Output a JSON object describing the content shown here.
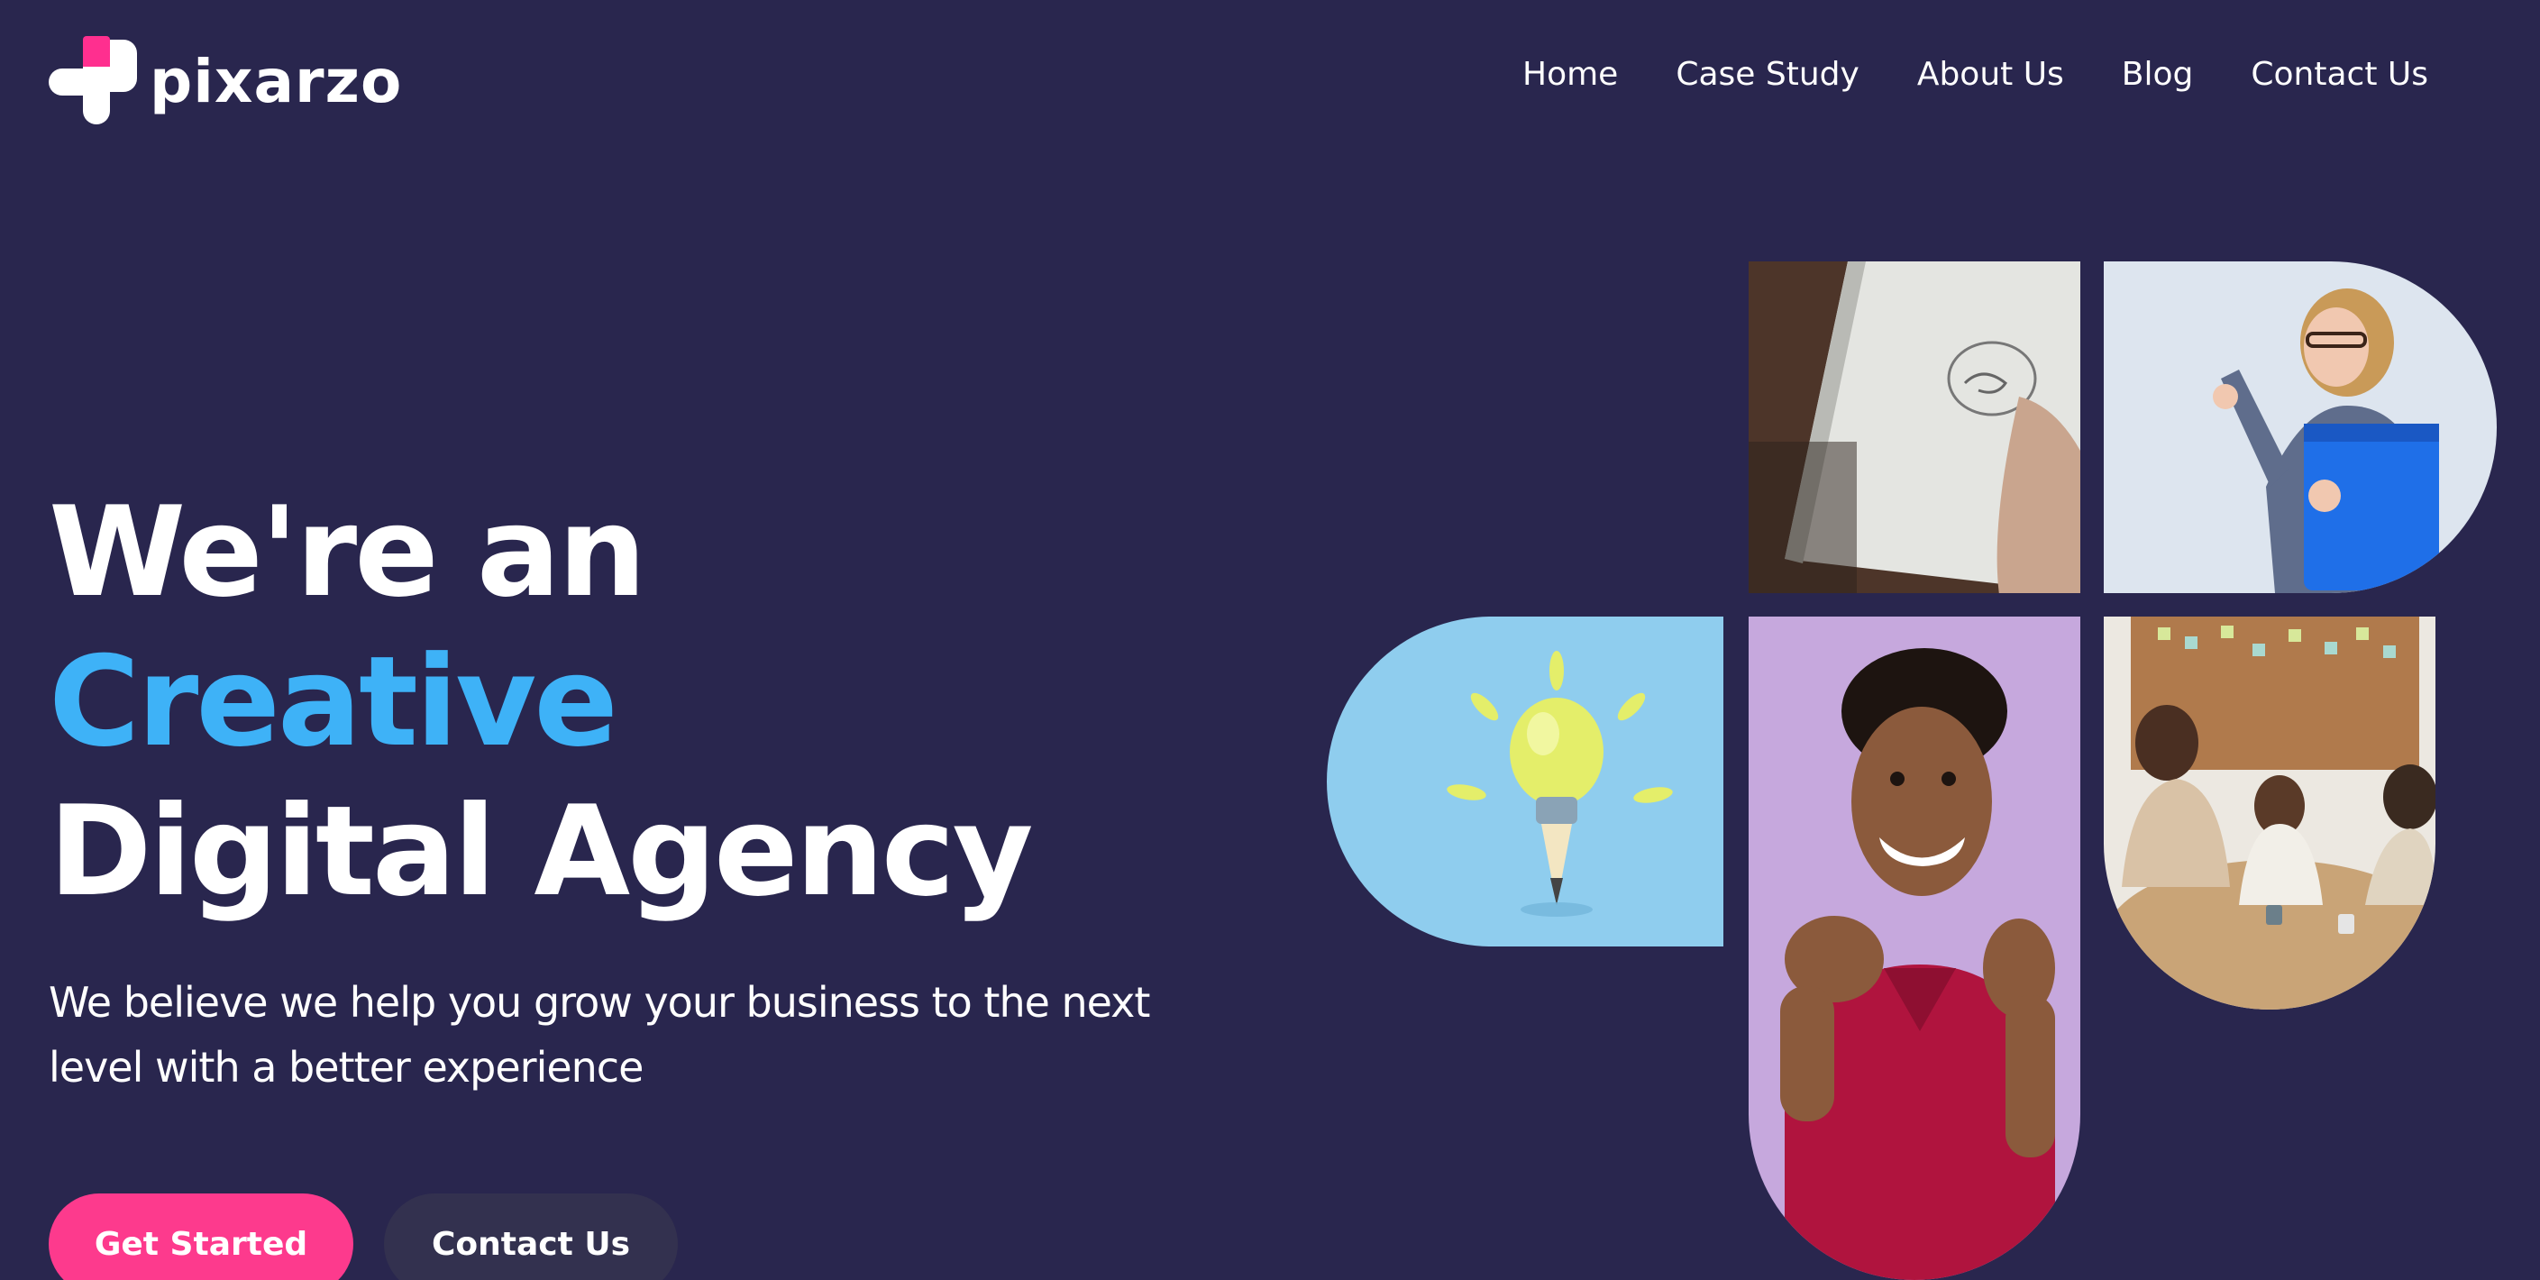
{
  "brand": {
    "name": "pixarzo"
  },
  "nav": {
    "items": [
      {
        "label": "Home"
      },
      {
        "label": "Case Study"
      },
      {
        "label": "About Us"
      },
      {
        "label": "Blog"
      },
      {
        "label": "Contact Us"
      }
    ]
  },
  "hero": {
    "headline_part1": "We're an ",
    "headline_accent": "Creative",
    "headline_part2": "Digital Agency",
    "subtext": "We believe we help you grow your business to the next level with a better experience",
    "primary_button": "Get Started",
    "secondary_button": "Contact Us"
  },
  "colors": {
    "background": "#29264e",
    "accent_blue": "#3eb2f7",
    "accent_pink": "#fd3a8d",
    "secondary_button": "#33314f"
  }
}
